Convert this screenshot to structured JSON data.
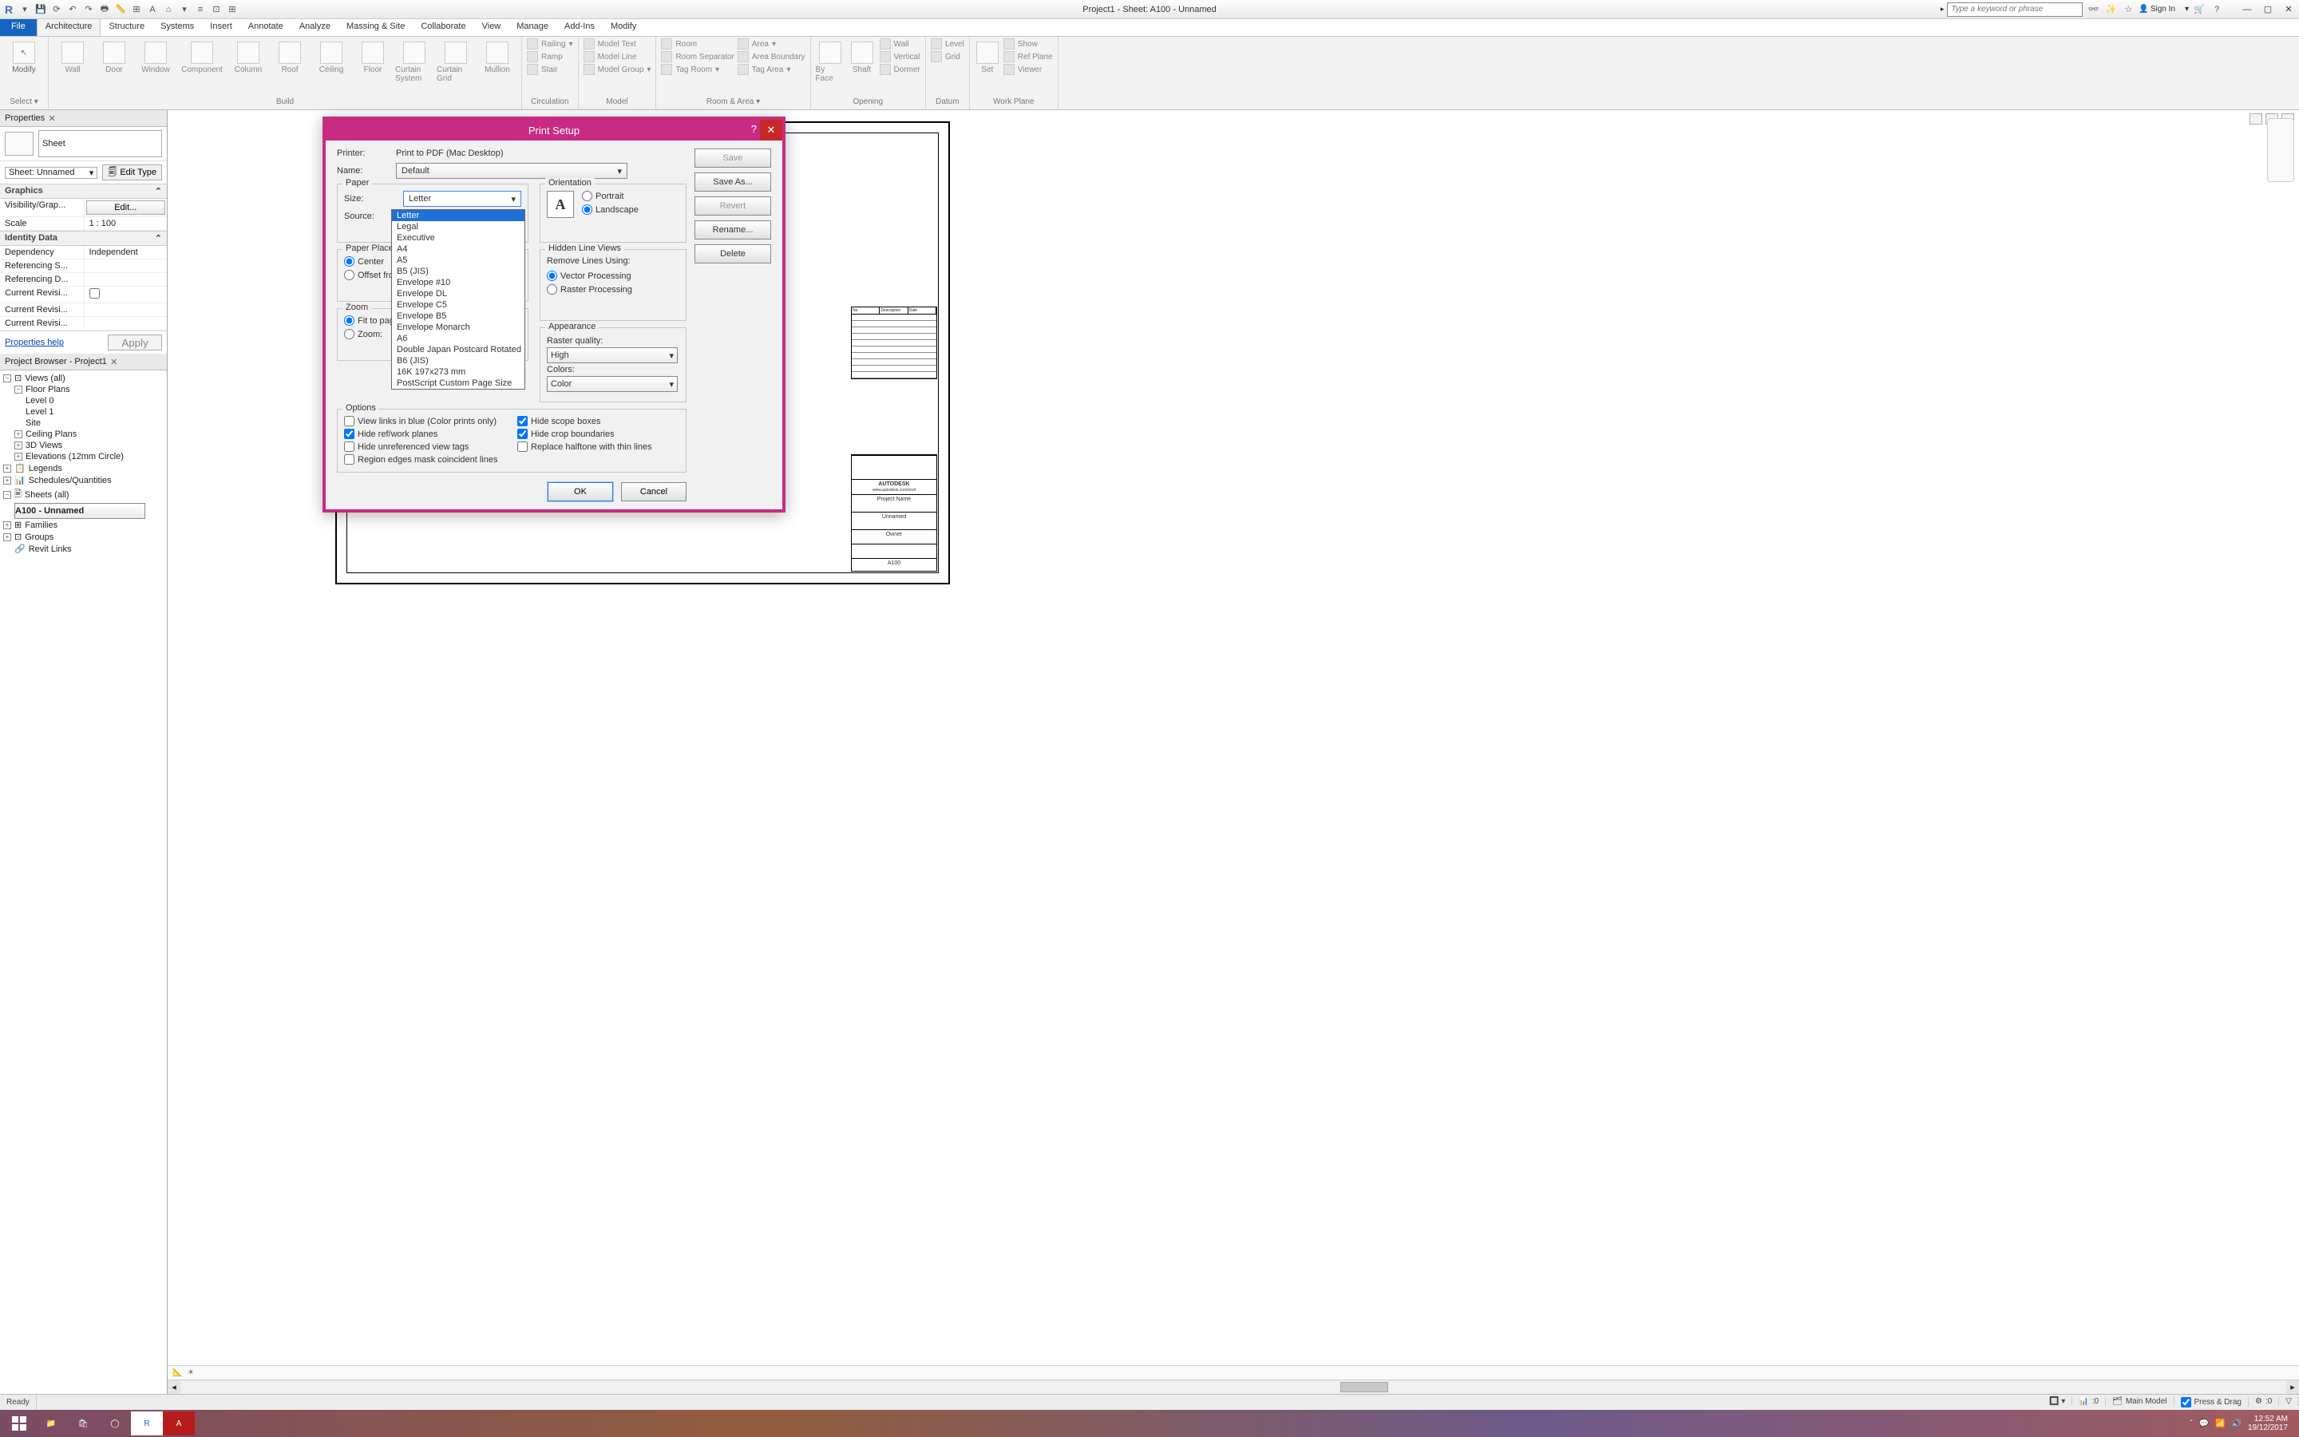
{
  "window": {
    "title": "Project1 - Sheet: A100 - Unnamed",
    "search_placeholder": "Type a keyword or phrase",
    "signin": "Sign In"
  },
  "ribbon": {
    "tabs": {
      "file": "File",
      "architecture": "Architecture",
      "structure": "Structure",
      "systems": "Systems",
      "insert": "Insert",
      "annotate": "Annotate",
      "analyze": "Analyze",
      "massing": "Massing & Site",
      "collaborate": "Collaborate",
      "view": "View",
      "manage": "Manage",
      "addins": "Add-Ins",
      "modify": "Modify"
    },
    "groups": {
      "select": "Select ▾",
      "modify": "Modify",
      "build_items": {
        "wall": "Wall",
        "door": "Door",
        "window": "Window",
        "component": "Component",
        "column": "Column",
        "roof": "Roof",
        "ceiling": "Ceiling",
        "floor": "Floor",
        "curtain_system": "Curtain System",
        "curtain_grid": "Curtain Grid",
        "mullion": "Mullion"
      },
      "build": "Build",
      "circulation": {
        "railing": "Railing",
        "ramp": "Ramp",
        "stair": "Stair",
        "label": "Circulation"
      },
      "model": {
        "text": "Model Text",
        "line": "Model Line",
        "group": "Model Group",
        "label": "Model"
      },
      "room_area": {
        "room": "Room",
        "separator": "Room Separator",
        "tag_room": "Tag Room",
        "area": "Area",
        "area_boundary": "Area Boundary",
        "tag_area": "Tag Area",
        "label": "Room & Area ▾"
      },
      "opening": {
        "by_face": "By Face",
        "shaft": "Shaft",
        "wall": "Wall",
        "vertical": "Vertical",
        "dormer": "Dormer",
        "label": "Opening"
      },
      "datum": {
        "level": "Level",
        "grid": "Grid",
        "label": "Datum"
      },
      "work_plane": {
        "set": "Set",
        "show": "Show",
        "ref_plane": "Ref Plane",
        "viewer": "Viewer",
        "label": "Work Plane"
      }
    }
  },
  "properties": {
    "panel_title": "Properties",
    "type": "Sheet",
    "instance_combo": "Sheet: Unnamed",
    "edit_type": "Edit Type",
    "sections": {
      "graphics": "Graphics",
      "identity": "Identity Data"
    },
    "rows": {
      "visibility": "Visibility/Grap...",
      "visibility_val": "Edit...",
      "scale": "Scale",
      "scale_val": "1 : 100",
      "dependency": "Dependency",
      "dependency_val": "Independent",
      "ref_s": "Referencing S...",
      "ref_d": "Referencing D...",
      "cur_rev": "Current Revisi...",
      "cur_rev2": "Current Revisi...",
      "cur_rev3": "Current Revisi..."
    },
    "help": "Properties help",
    "apply": "Apply"
  },
  "browser": {
    "title": "Project Browser - Project1",
    "views_all": "Views (all)",
    "floor_plans": "Floor Plans",
    "level0": "Level 0",
    "level1": "Level 1",
    "site": "Site",
    "ceiling_plans": "Ceiling Plans",
    "3d": "3D Views",
    "elevations": "Elevations (12mm Circle)",
    "legends": "Legends",
    "schedules": "Schedules/Quantities",
    "sheets": "Sheets (all)",
    "sheet_a100": "A100 - Unnamed",
    "families": "Families",
    "groups": "Groups",
    "revit_links": "Revit Links"
  },
  "dialog": {
    "title": "Print Setup",
    "printer_label": "Printer:",
    "printer_val": "Print to PDF (Mac Desktop)",
    "name_label": "Name:",
    "name_val": "Default",
    "paper": {
      "title": "Paper",
      "size_label": "Size:",
      "size_value": "Letter",
      "source_label": "Source:",
      "options": [
        "Letter",
        "Legal",
        "Executive",
        "A4",
        "A5",
        "B5 (JIS)",
        "Envelope #10",
        "Envelope DL",
        "Envelope C5",
        "Envelope B5",
        "Envelope Monarch",
        "A6",
        "Double Japan Postcard Rotated",
        "B6 (JIS)",
        "16K 197x273 mm",
        "PostScript Custom Page Size"
      ]
    },
    "orientation": {
      "title": "Orientation",
      "portrait": "Portrait",
      "landscape": "Landscape"
    },
    "placement": {
      "title": "Paper Placement",
      "center": "Center",
      "offset": "Offset from corner:"
    },
    "hidden_line": {
      "title": "Hidden Line Views",
      "remove_label": "Remove Lines Using:",
      "vector": "Vector Processing",
      "raster": "Raster Processing"
    },
    "zoom": {
      "title": "Zoom",
      "fit": "Fit to page",
      "zoom": "Zoom:"
    },
    "appearance": {
      "title": "Appearance",
      "rq_label": "Raster quality:",
      "rq_val": "High",
      "colors_label": "Colors:",
      "colors_val": "Color"
    },
    "options": {
      "title": "Options",
      "links_blue": "View links in blue (Color prints only)",
      "hide_ref": "Hide ref/work planes",
      "hide_unref": "Hide unreferenced view tags",
      "region_edges": "Region edges mask coincident lines",
      "hide_scope": "Hide scope boxes",
      "hide_crop": "Hide crop boundaries",
      "replace_halftone": "Replace halftone with thin lines"
    },
    "buttons": {
      "save": "Save",
      "save_as": "Save As...",
      "revert": "Revert",
      "rename": "Rename...",
      "delete": "Delete",
      "ok": "OK",
      "cancel": "Cancel"
    }
  },
  "sheet": {
    "rev_headers": {
      "no": "No",
      "desc": "Description",
      "date": "Date"
    },
    "autodesk": "AUTODESK",
    "autodesk_url": "www.autodesk.com/revit",
    "project_name": "Project Name",
    "sheet_name": "Unnamed",
    "owner": "Owner",
    "sheet_no": "A100"
  },
  "status": {
    "ready": "Ready",
    "zero": ":0",
    "main_model": "Main Model",
    "press_drag": "Press & Drag",
    "zero2": ":0"
  },
  "taskbar": {
    "time": "12:52 AM",
    "date": "19/12/2017"
  }
}
